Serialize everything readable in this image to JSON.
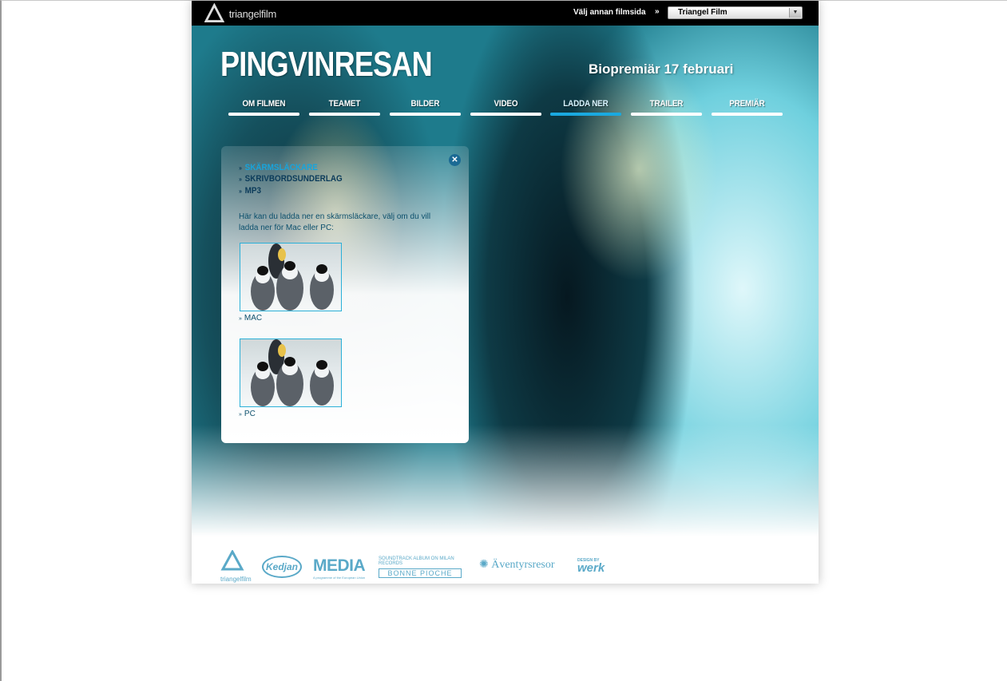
{
  "header": {
    "logo_text": "triangelfilm",
    "other_film_label": "Välj annan filmsida",
    "other_film_arrow": "»",
    "film_select_value": "Triangel Film"
  },
  "hero": {
    "title": "PINGVINRESAN",
    "premiere": "Biopremiär 17 februari"
  },
  "nav": {
    "items": [
      {
        "label": "OM FILMEN"
      },
      {
        "label": "TEAMET"
      },
      {
        "label": "BILDER"
      },
      {
        "label": "VIDEO"
      },
      {
        "label": "LADDA NER",
        "active": true
      },
      {
        "label": "TRAILER"
      },
      {
        "label": "PREMIÄR"
      }
    ]
  },
  "panel": {
    "close_icon": "close-icon",
    "submenu": [
      {
        "label": "SKÄRMSLÄCKARE",
        "active": true
      },
      {
        "label": "SKRIVBORDSUNDERLAG"
      },
      {
        "label": "MP3"
      }
    ],
    "intro_text": "Här kan du ladda ner en skärmsläckare, välj om du vill ladda ner för Mac eller PC:",
    "downloads": [
      {
        "label": "MAC"
      },
      {
        "label": "PC"
      }
    ]
  },
  "sponsors": {
    "triangel": "triangelfilm",
    "kedjan": "Kedjan",
    "media": "MEDIA",
    "media_sub": "A programme of the European Union",
    "soundtrack": "SOUNDTRACK ALBUM ON MILAN RECORDS",
    "bonne": "BONNE PIOCHE",
    "aventyr": "Äventyrsresor",
    "design_by": "DESIGN BY",
    "werk": "werk"
  },
  "colors": {
    "accent": "#1aa9e0",
    "text_dark": "#0b3b5a",
    "topbar": "#000000"
  }
}
